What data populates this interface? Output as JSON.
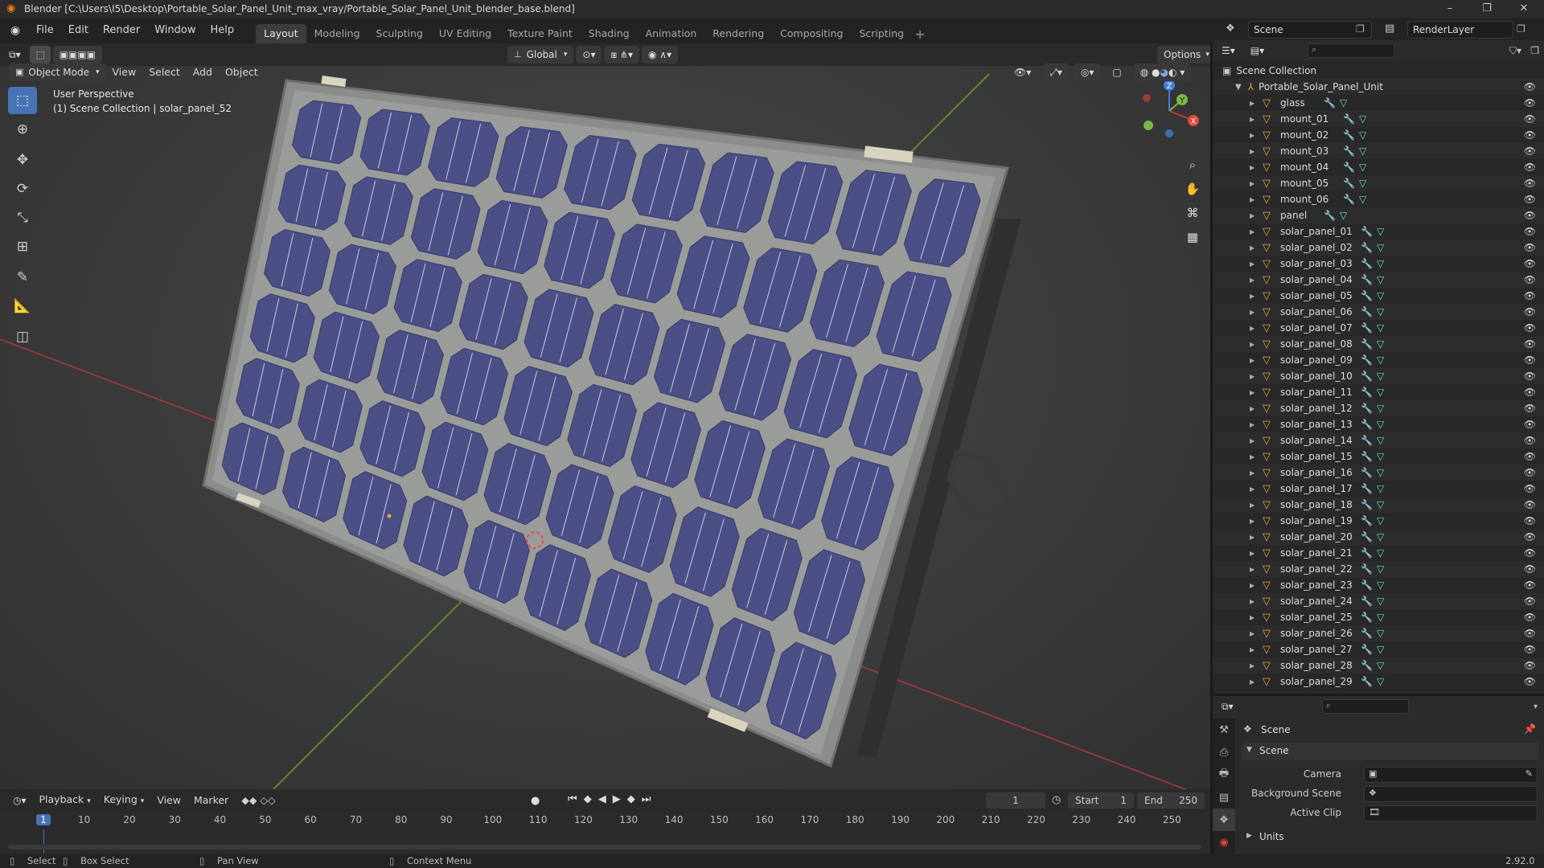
{
  "window": {
    "title": "Blender [C:\\Users\\I5\\Desktop\\Portable_Solar_Panel_Unit_max_vray/Portable_Solar_Panel_Unit_blender_base.blend]",
    "minimize": "–",
    "maximize": "❐",
    "close": "✕"
  },
  "menu": [
    "File",
    "Edit",
    "Render",
    "Window",
    "Help"
  ],
  "workspaces": [
    "Layout",
    "Modeling",
    "Sculpting",
    "UV Editing",
    "Texture Paint",
    "Shading",
    "Animation",
    "Rendering",
    "Compositing",
    "Scripting"
  ],
  "active_workspace": "Layout",
  "scene_name": "Scene",
  "render_layer": "RenderLayer",
  "viewport": {
    "mode": "Object Mode",
    "menus": [
      "View",
      "Select",
      "Add",
      "Object"
    ],
    "transform_orientation": "Global",
    "options_label": "Options",
    "perspective_label": "User Perspective",
    "collection_label": "(1) Scene Collection | solar_panel_52",
    "gizmo": {
      "x": "X",
      "y": "Y",
      "z": "Z"
    }
  },
  "timeline": {
    "menus": [
      "Playback",
      "Keying",
      "View",
      "Marker"
    ],
    "current_frame": "1",
    "start_label": "Start",
    "start": "1",
    "end_label": "End",
    "end": "250",
    "ruler": [
      "1",
      "10",
      "20",
      "30",
      "40",
      "50",
      "60",
      "70",
      "80",
      "90",
      "100",
      "110",
      "120",
      "130",
      "140",
      "150",
      "160",
      "170",
      "180",
      "190",
      "200",
      "210",
      "220",
      "230",
      "240",
      "250"
    ]
  },
  "outliner": {
    "root": "Scene Collection",
    "collection": "Portable_Solar_Panel_Unit",
    "objects": [
      "glass",
      "mount_01",
      "mount_02",
      "mount_03",
      "mount_04",
      "mount_05",
      "mount_06",
      "panel",
      "solar_panel_01",
      "solar_panel_02",
      "solar_panel_03",
      "solar_panel_04",
      "solar_panel_05",
      "solar_panel_06",
      "solar_panel_07",
      "solar_panel_08",
      "solar_panel_09",
      "solar_panel_10",
      "solar_panel_11",
      "solar_panel_12",
      "solar_panel_13",
      "solar_panel_14",
      "solar_panel_15",
      "solar_panel_16",
      "solar_panel_17",
      "solar_panel_18",
      "solar_panel_19",
      "solar_panel_20",
      "solar_panel_21",
      "solar_panel_22",
      "solar_panel_23",
      "solar_panel_24",
      "solar_panel_25",
      "solar_panel_26",
      "solar_panel_27",
      "solar_panel_28",
      "solar_panel_29"
    ]
  },
  "properties": {
    "context": "Scene",
    "panel": "Scene",
    "camera_label": "Camera",
    "background_scene_label": "Background Scene",
    "active_clip_label": "Active Clip",
    "units_label": "Units"
  },
  "status": {
    "select": "Select",
    "box_select": "Box Select",
    "pan_view": "Pan View",
    "context_menu": "Context Menu",
    "version": "2.92.0"
  },
  "colors": {
    "accent": "#4772b3",
    "object_icon": "#e8a33d",
    "mesh_icon": "#6ee0b8",
    "modifier_icon": "#7ea8e6",
    "cell": "#4b4f86",
    "frame": "#8a8d8a",
    "axis_x": "#c0392b",
    "axis_y": "#7ab648",
    "axis_z": "#3f7fd8"
  }
}
